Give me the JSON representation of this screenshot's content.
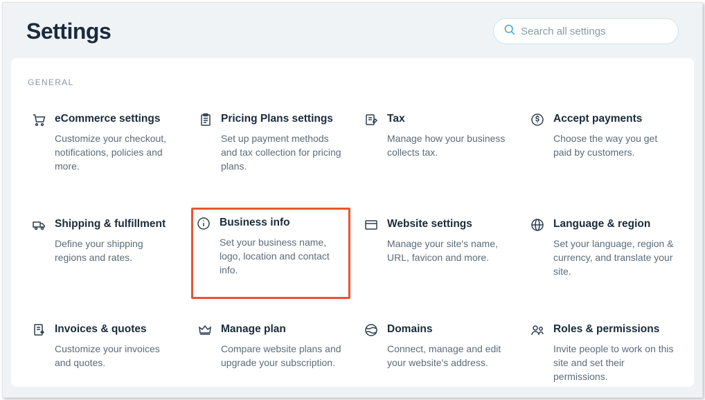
{
  "header": {
    "title": "Settings",
    "search_placeholder": "Search all settings"
  },
  "section_label": "GENERAL",
  "tiles": [
    {
      "icon": "cart",
      "title": "eCommerce settings",
      "desc": "Customize your checkout, notifications, policies and more."
    },
    {
      "icon": "clipboard",
      "title": "Pricing Plans settings",
      "desc": "Set up payment methods and tax collection for pricing plans."
    },
    {
      "icon": "tax",
      "title": "Tax",
      "desc": "Manage how your business collects tax."
    },
    {
      "icon": "dollar",
      "title": "Accept payments",
      "desc": "Choose the way you get paid by customers."
    },
    {
      "icon": "truck",
      "title": "Shipping & fulfillment",
      "desc": "Define your shipping regions and rates."
    },
    {
      "icon": "info",
      "title": "Business info",
      "desc": "Set your business name, logo, location and contact info.",
      "highlighted": true
    },
    {
      "icon": "browser",
      "title": "Website settings",
      "desc": "Manage your site's name, URL, favicon and more."
    },
    {
      "icon": "globe",
      "title": "Language & region",
      "desc": "Set your language, region & currency, and translate your site."
    },
    {
      "icon": "invoice",
      "title": "Invoices & quotes",
      "desc": "Customize your invoices and quotes."
    },
    {
      "icon": "crown",
      "title": "Manage plan",
      "desc": "Compare website plans and upgrade your subscription."
    },
    {
      "icon": "globe2",
      "title": "Domains",
      "desc": "Connect, manage and edit your website's address."
    },
    {
      "icon": "people",
      "title": "Roles & permissions",
      "desc": "Invite people to work on this site and set their permissions."
    }
  ]
}
